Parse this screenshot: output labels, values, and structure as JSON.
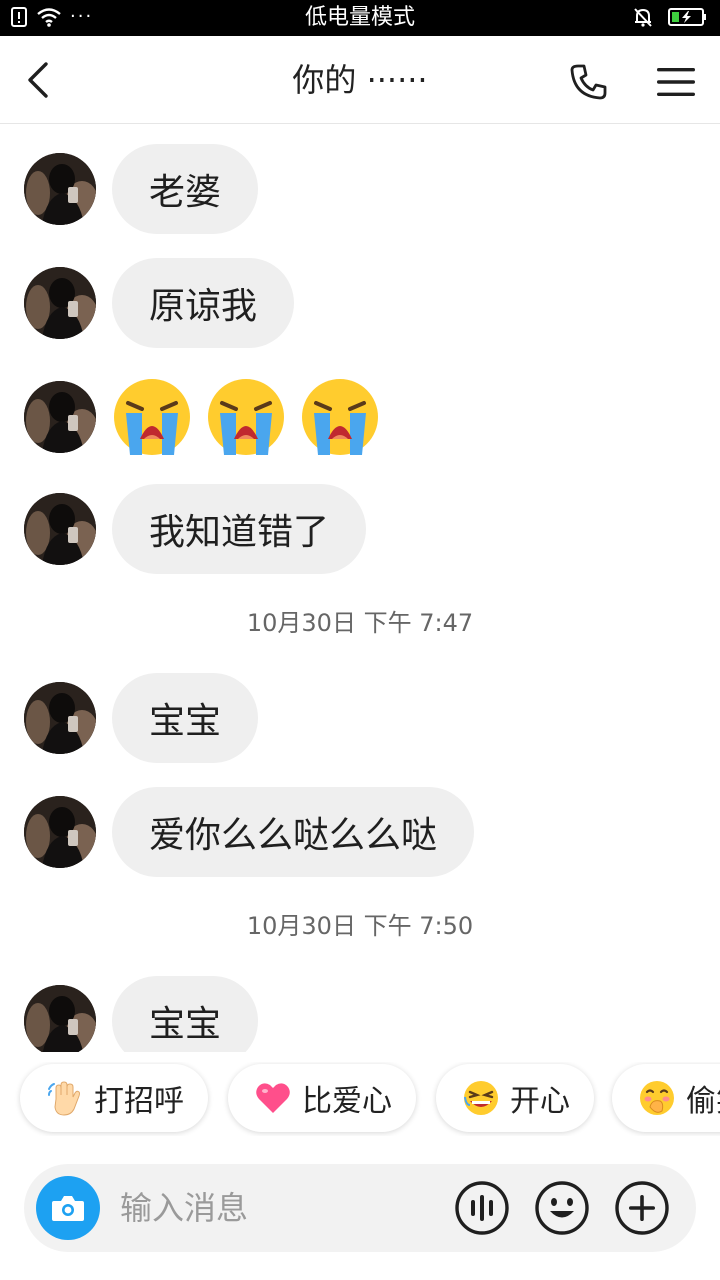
{
  "status_bar": {
    "center_text": "低电量模式",
    "left_dots": "···",
    "icons": [
      "sim-icon",
      "wifi-icon",
      "mute-bell-icon",
      "battery-charging-icon"
    ]
  },
  "header": {
    "title": "你的 ······",
    "icons": [
      "back-chevron-icon",
      "phone-icon",
      "hamburger-menu-icon"
    ]
  },
  "messages": [
    {
      "type": "text",
      "text": "老婆"
    },
    {
      "type": "text",
      "text": "原谅我"
    },
    {
      "type": "emoji",
      "emoji": [
        "loudly-crying-face",
        "loudly-crying-face",
        "loudly-crying-face"
      ]
    },
    {
      "type": "text",
      "text": "我知道错了"
    },
    {
      "type": "timestamp",
      "text": "10月30日 下午 7:47"
    },
    {
      "type": "text",
      "text": "宝宝"
    },
    {
      "type": "text",
      "text": "爱你么么哒么么哒"
    },
    {
      "type": "timestamp",
      "text": "10月30日 下午 7:50"
    },
    {
      "type": "text",
      "text": "宝宝"
    }
  ],
  "quick_replies": [
    {
      "label": "打招呼",
      "icon": "waving-hand-icon"
    },
    {
      "label": "比爱心",
      "icon": "pink-heart-icon"
    },
    {
      "label": "开心",
      "icon": "laughing-face-icon"
    },
    {
      "label": "偷笑",
      "icon": "hand-over-mouth-face-icon"
    }
  ],
  "composer": {
    "placeholder": "输入消息",
    "icons": [
      "camera-icon",
      "voice-icon",
      "emoji-icon",
      "plus-icon"
    ]
  },
  "colors": {
    "accent_blue": "#1da1f2",
    "bubble_bg": "#efefef",
    "composer_bg": "#f2f2f2",
    "crying_face_yellow": "#ffcc2e",
    "tears_blue": "#4aa6ee"
  }
}
